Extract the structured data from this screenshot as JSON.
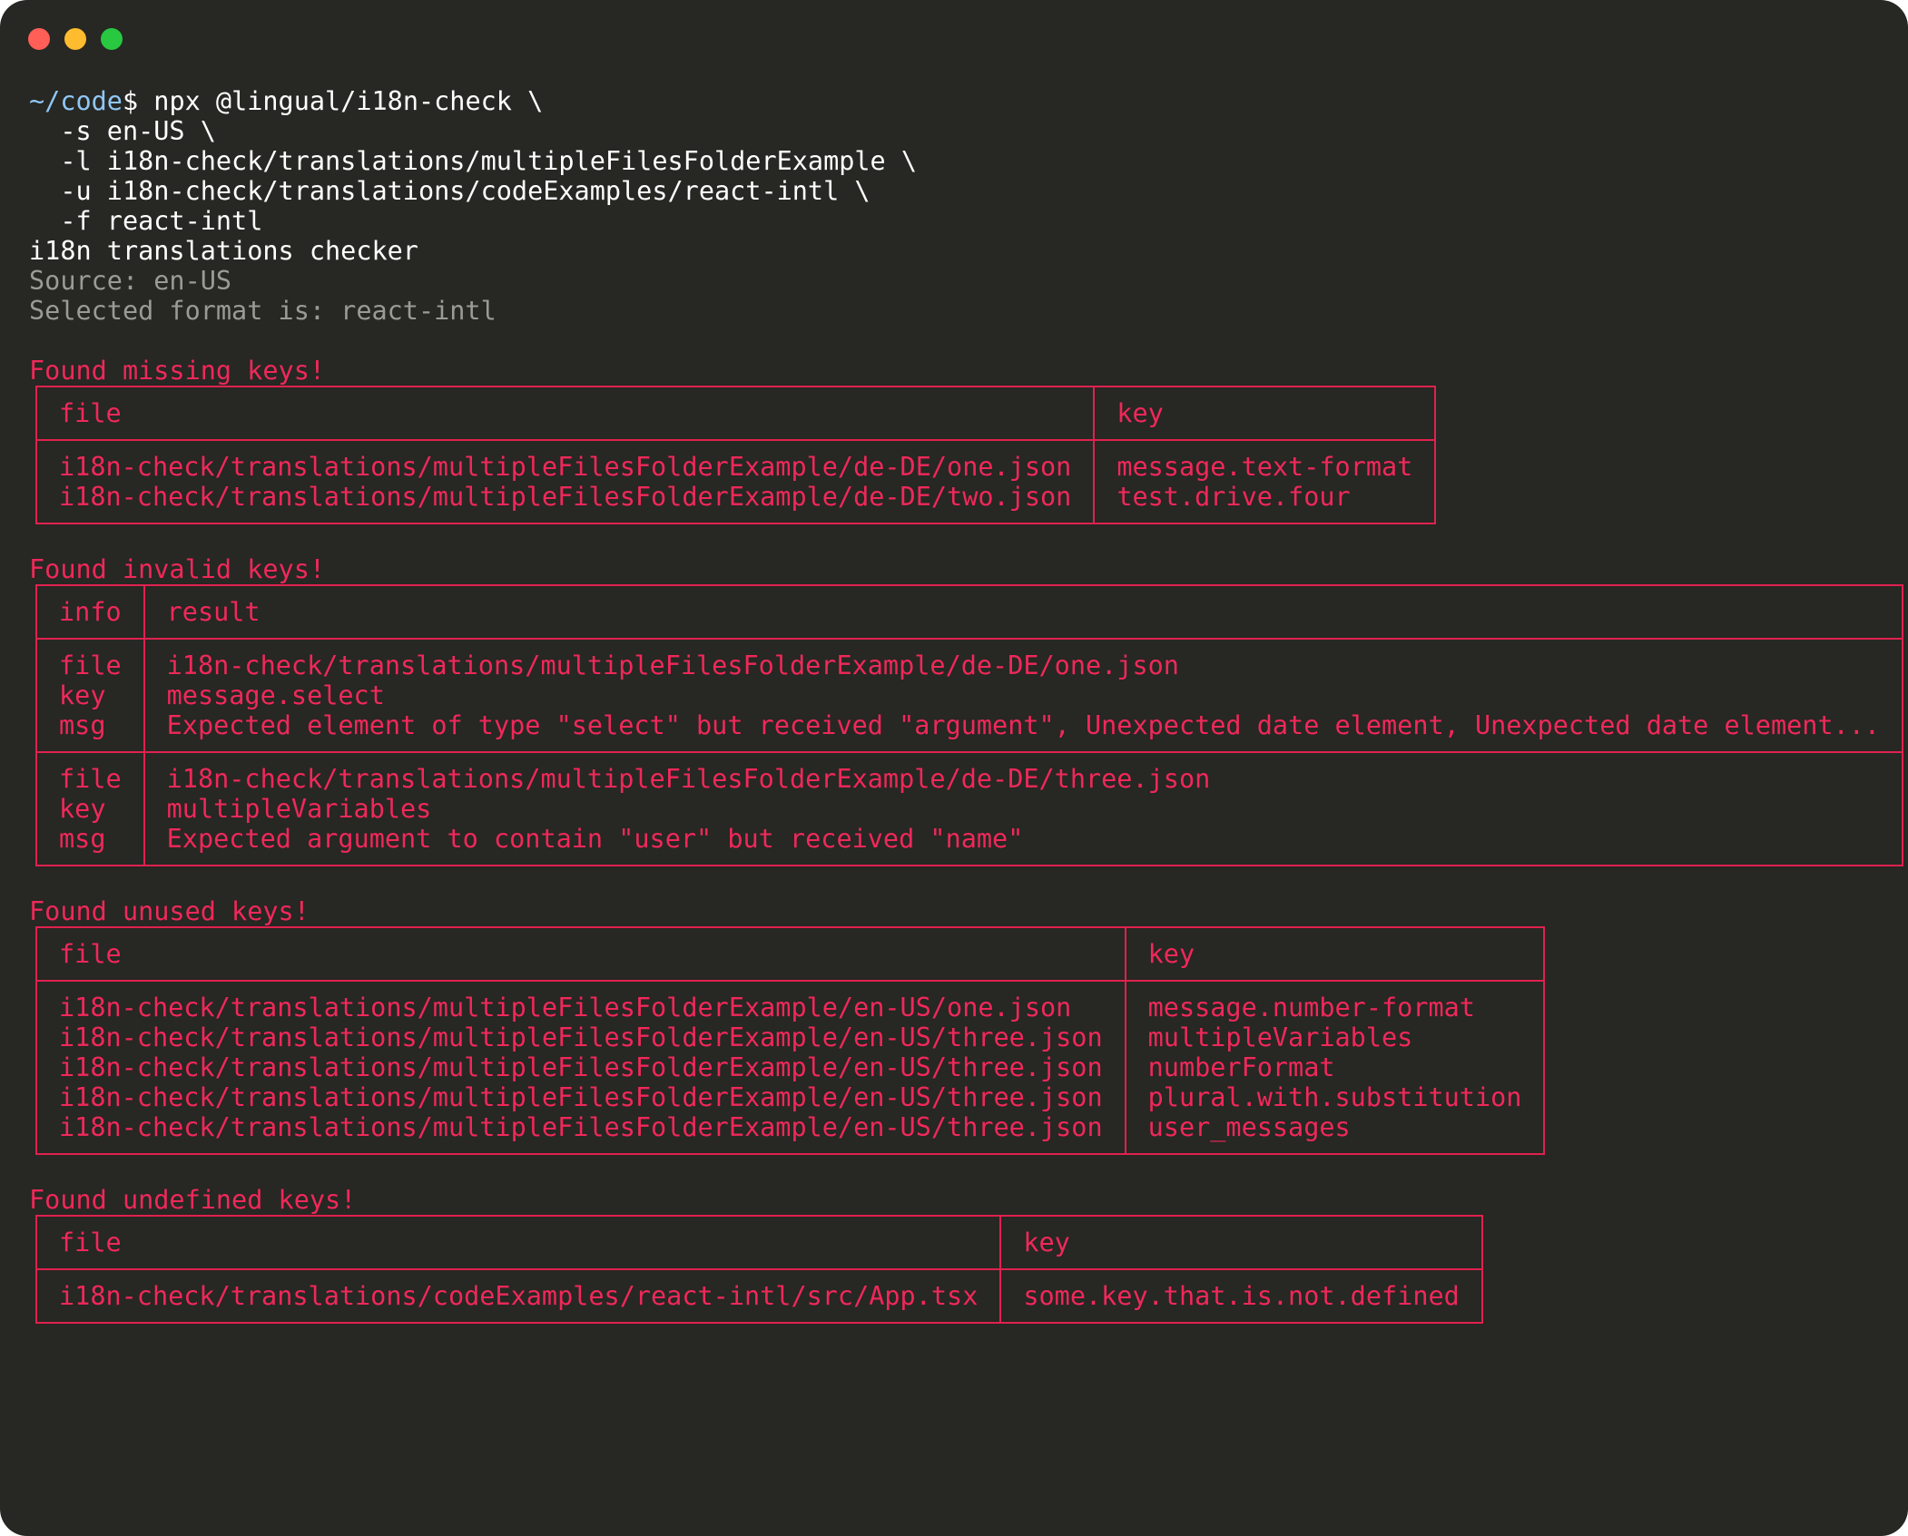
{
  "window": {
    "controls": [
      "close",
      "minimize",
      "maximize"
    ]
  },
  "command": {
    "prompt_path": "~/code",
    "prompt_symbol": "$",
    "lines": [
      " npx @lingual/i18n-check \\",
      "  -s en-US \\",
      "  -l i18n-check/translations/multipleFilesFolderExample \\",
      "  -u i18n-check/translations/codeExamples/react-intl \\",
      "  -f react-intl"
    ]
  },
  "output": {
    "title": "i18n translations checker",
    "source": "Source: en-US",
    "format": "Selected format is: react-intl"
  },
  "missing": {
    "heading": "Found missing keys!",
    "col_file": "file",
    "col_key": "key",
    "files": [
      "i18n-check/translations/multipleFilesFolderExample/de-DE/one.json",
      "i18n-check/translations/multipleFilesFolderExample/de-DE/two.json"
    ],
    "keys": [
      "message.text-format",
      "test.drive.four"
    ]
  },
  "invalid": {
    "heading": "Found invalid keys!",
    "col_info": "info",
    "col_result": "result",
    "info_labels": [
      "file",
      "key",
      "msg"
    ],
    "entries": [
      {
        "file": "i18n-check/translations/multipleFilesFolderExample/de-DE/one.json",
        "key": "message.select",
        "msg": "Expected element of type \"select\" but received \"argument\", Unexpected date element, Unexpected date element..."
      },
      {
        "file": "i18n-check/translations/multipleFilesFolderExample/de-DE/three.json",
        "key": "multipleVariables",
        "msg": "Expected argument to contain \"user\" but received \"name\""
      }
    ]
  },
  "unused": {
    "heading": "Found unused keys!",
    "col_file": "file",
    "col_key": "key",
    "files": [
      "i18n-check/translations/multipleFilesFolderExample/en-US/one.json",
      "i18n-check/translations/multipleFilesFolderExample/en-US/three.json",
      "i18n-check/translations/multipleFilesFolderExample/en-US/three.json",
      "i18n-check/translations/multipleFilesFolderExample/en-US/three.json",
      "i18n-check/translations/multipleFilesFolderExample/en-US/three.json"
    ],
    "keys": [
      "message.number-format",
      "multipleVariables",
      "numberFormat",
      "plural.with.substitution",
      "user_messages"
    ]
  },
  "undefined": {
    "heading": "Found undefined keys!",
    "col_file": "file",
    "col_key": "key",
    "files": [
      "i18n-check/translations/codeExamples/react-intl/src/App.tsx"
    ],
    "keys": [
      "some.key.that.is.not.defined"
    ]
  }
}
